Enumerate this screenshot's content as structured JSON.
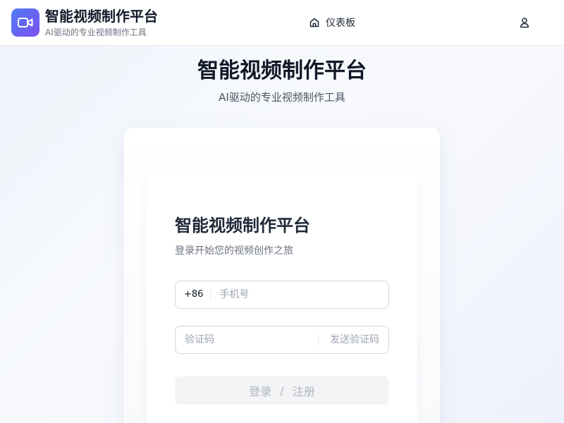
{
  "header": {
    "logo_icon": "video-camera-icon",
    "title": "智能视频制作平台",
    "subtitle": "AI驱动的专业视频制作工具",
    "nav": {
      "dashboard_label": "仪表板",
      "dashboard_icon": "home-icon"
    },
    "user_icon": "user-icon"
  },
  "hero": {
    "title": "智能视频制作平台",
    "subtitle": "AI驱动的专业视频制作工具"
  },
  "login_form": {
    "title": "智能视频制作平台",
    "subtitle": "登录开始您的视频创作之旅",
    "phone": {
      "prefix": "+86",
      "placeholder": "手机号",
      "value": ""
    },
    "code": {
      "placeholder": "验证码",
      "value": "",
      "send_label": "发送验证码"
    },
    "submit": {
      "login_label": "登录",
      "separator": "/",
      "register_label": "注册"
    }
  },
  "colors": {
    "accent_gradient_start": "#4f7cf6",
    "accent_gradient_end": "#7c4ff0",
    "disabled_button_bg": "#f3f4f6",
    "disabled_text": "#b0b5bd"
  }
}
